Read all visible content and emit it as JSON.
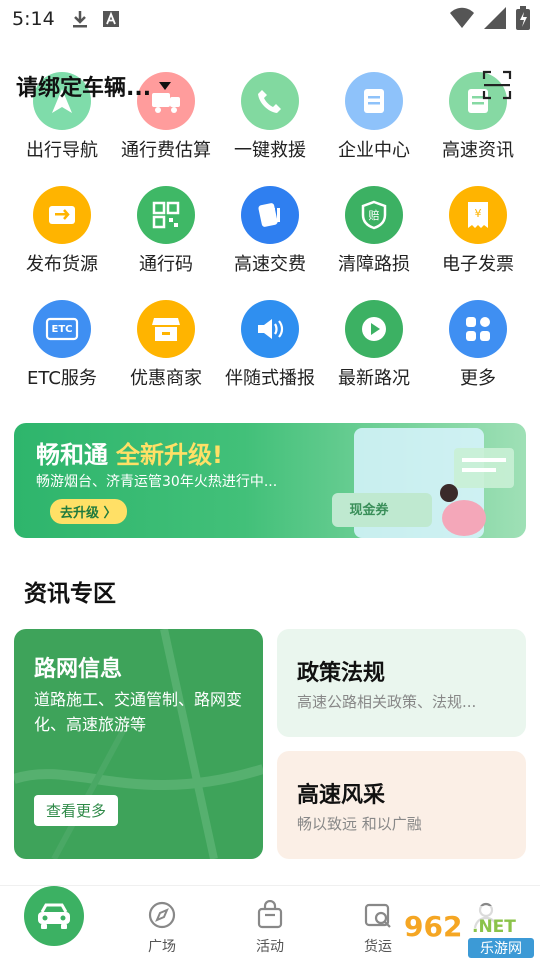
{
  "status_bar": {
    "time": "5:14",
    "left_icons": [
      "download-icon",
      "a-icon"
    ],
    "right_icons": [
      "wifi-icon",
      "signal-icon",
      "battery-icon"
    ]
  },
  "header": {
    "vehicle_prompt": "请绑定车辆...",
    "scan_icon": "scan-icon"
  },
  "grid": {
    "items": [
      {
        "label": "出行导航",
        "icon": "navigation-icon",
        "color": "#4cc77e"
      },
      {
        "label": "通行费估算",
        "icon": "toll-estimate-icon",
        "color": "#ff6b6b"
      },
      {
        "label": "一键救援",
        "icon": "phone-icon",
        "color": "#3fc070"
      },
      {
        "label": "企业中心",
        "icon": "document-icon",
        "color": "#4a9cf5"
      },
      {
        "label": "高速资讯",
        "icon": "news-icon",
        "color": "#3fc070"
      },
      {
        "label": "发布货源",
        "icon": "cargo-icon",
        "color": "#ffb400"
      },
      {
        "label": "通行码",
        "icon": "qr-code-icon",
        "color": "#3fb866"
      },
      {
        "label": "高速交费",
        "icon": "card-payment-icon",
        "color": "#2f7ff0"
      },
      {
        "label": "清障路损",
        "icon": "shield-icon",
        "color": "#3cb163"
      },
      {
        "label": "电子发票",
        "icon": "invoice-icon",
        "color": "#ffb400"
      },
      {
        "label": "ETC服务",
        "icon": "etc-icon",
        "color": "#3f8ff2"
      },
      {
        "label": "优惠商家",
        "icon": "store-icon",
        "color": "#ffb400"
      },
      {
        "label": "伴随式播报",
        "icon": "speaker-icon",
        "color": "#2f8ff0"
      },
      {
        "label": "最新路况",
        "icon": "play-icon",
        "color": "#3cb163"
      },
      {
        "label": "更多",
        "icon": "grid-more-icon",
        "color": "#3f8ff2"
      }
    ]
  },
  "banner": {
    "title": "畅和通",
    "highlight": "全新升级!",
    "subtitle": "畅游烟台、济青运管30年火热进行中...",
    "button": "去升级 〉",
    "coupon_text": "现金券"
  },
  "section": {
    "title": "资讯专区"
  },
  "cards": {
    "roadnet": {
      "title": "路网信息",
      "desc": "道路施工、交通管制、路网变化、高速旅游等",
      "button": "查看更多"
    },
    "policy": {
      "title": "政策法规",
      "desc": "高速公路相关政策、法规..."
    },
    "style": {
      "title": "高速风采",
      "desc": "畅以致远 和以广融"
    }
  },
  "bottom_nav": {
    "items": [
      {
        "label": "",
        "icon": "car-icon"
      },
      {
        "label": "广场",
        "icon": "compass-icon"
      },
      {
        "label": "活动",
        "icon": "gift-bag-icon"
      },
      {
        "label": "货运",
        "icon": "cargo-search-icon"
      },
      {
        "label": "",
        "icon": "profile-icon"
      }
    ]
  },
  "watermark": {
    "brand": "962",
    "suffix": ".NET",
    "site": "乐游网"
  },
  "colors": {
    "primary_green": "#3cb163",
    "banner_yellow": "#ffe066"
  }
}
